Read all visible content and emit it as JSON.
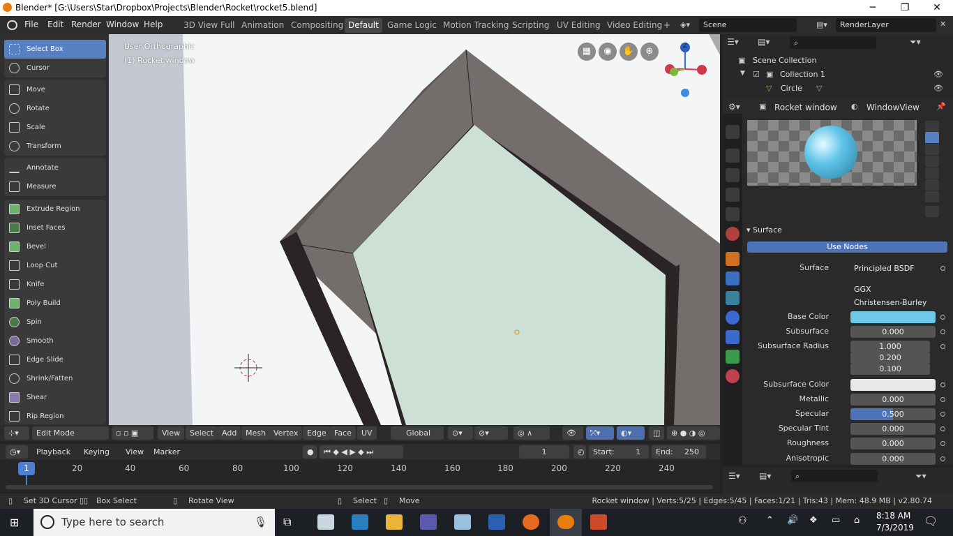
{
  "window": {
    "title": "Blender* [G:\\Users\\Star\\Dropbox\\Projects\\Blender\\Rocket\\rocket5.blend]",
    "minimize": "─",
    "maximize": "❐",
    "close": "✕"
  },
  "menu": [
    "File",
    "Edit",
    "Render",
    "Window",
    "Help"
  ],
  "workspaces": [
    "3D View Full",
    "Animation",
    "Compositing",
    "Default",
    "Game Logic",
    "Motion Tracking",
    "Scripting",
    "UV Editing",
    "Video Editing",
    "+"
  ],
  "scene": "Scene",
  "renderlayer": "RenderLayer",
  "tools": [
    "Select Box",
    "Cursor",
    "Move",
    "Rotate",
    "Scale",
    "Transform",
    "Annotate",
    "Measure",
    "Extrude Region",
    "Inset Faces",
    "Bevel",
    "Loop Cut",
    "Knife",
    "Poly Build",
    "Spin",
    "Smooth",
    "Edge Slide",
    "Shrink/Fatten",
    "Shear",
    "Rip Region"
  ],
  "viewport": {
    "view_name": "User Orthographic",
    "object_label": "(1) Rocket window",
    "axis_z": "Z"
  },
  "view_header": {
    "mode": "Edit Mode",
    "menus": [
      "View",
      "Select",
      "Add",
      "Mesh",
      "Vertex",
      "Edge",
      "Face",
      "UV"
    ],
    "orientation": "Global"
  },
  "timeline": {
    "menus": [
      "Playback",
      "Keying",
      "View",
      "Marker"
    ],
    "current_frame": "1",
    "start_label": "Start:",
    "start": "1",
    "end_label": "End:",
    "end": "250",
    "ticks": [
      "1",
      "20",
      "40",
      "60",
      "80",
      "100",
      "120",
      "140",
      "160",
      "180",
      "200",
      "220",
      "240"
    ]
  },
  "status": {
    "left": [
      "Set 3D Cursor",
      "Box Select",
      "Rotate View",
      "Select",
      "Move"
    ],
    "right": "Rocket window | Verts:5/25 | Edges:5/45 | Faces:1/21 | Tris:43 | Mem: 48.9 MB | v2.80.74"
  },
  "taskbar": {
    "search_placeholder": "Type here to search",
    "time": "8:18 AM",
    "date": "7/3/2019"
  },
  "outliner": {
    "root": "Scene Collection",
    "collection": "Collection 1",
    "object": "Circle"
  },
  "properties": {
    "object": "Rocket window",
    "world": "WindowView",
    "section": "Surface",
    "use_nodes": "Use Nodes",
    "rows": [
      {
        "label": "Surface",
        "value": "Principled BSDF"
      },
      {
        "label": "",
        "value": "GGX"
      },
      {
        "label": "",
        "value": "Christensen-Burley"
      },
      {
        "label": "Base Color",
        "value": ""
      },
      {
        "label": "Subsurface",
        "value": "0.000"
      },
      {
        "label": "Subsurface Radius",
        "value": "1.000"
      },
      {
        "label": "",
        "value": "0.200"
      },
      {
        "label": "",
        "value": "0.100"
      },
      {
        "label": "Subsurface Color",
        "value": ""
      },
      {
        "label": "Metallic",
        "value": "0.000"
      },
      {
        "label": "Specular",
        "value": "0.500"
      },
      {
        "label": "Specular Tint",
        "value": "0.000"
      },
      {
        "label": "Roughness",
        "value": "0.000"
      },
      {
        "label": "Anisotropic",
        "value": "0.000"
      }
    ],
    "base_color": "#6ec8e8",
    "subsurface_color": "#e8e8e8",
    "specular_fraction": 0.5
  },
  "colors": {
    "accent": "#5680c2",
    "face_fill": "#cce0d6",
    "frame": "#736e6b",
    "frame_dark": "#2a2524"
  }
}
